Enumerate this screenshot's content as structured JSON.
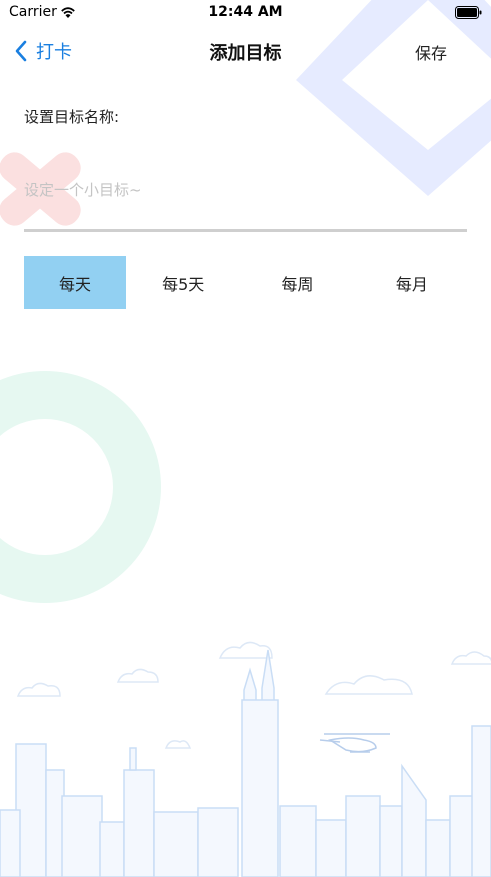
{
  "status_bar": {
    "carrier": "Carrier",
    "time": "12:44 AM",
    "wifi_icon": "wifi-icon",
    "battery_icon": "battery-icon"
  },
  "nav": {
    "back_label": "打卡",
    "back_icon": "chevron-left-icon",
    "title": "添加目标",
    "save_label": "保存"
  },
  "form": {
    "name_label": "设置目标名称:",
    "name_value": "",
    "name_placeholder": "设定一个小目标~"
  },
  "frequency": {
    "selected_index": 0,
    "options": [
      "每天",
      "每5天",
      "每周",
      "每月"
    ]
  },
  "colors": {
    "accent": "#1a7fe0",
    "selected_bg": "#92d0f2",
    "underline": "#cfcfcf",
    "deco_blue": "#e6ebff",
    "deco_red": "#fbe0e0",
    "deco_green": "#e6f8f1",
    "skyline": "#c9ddf5"
  }
}
